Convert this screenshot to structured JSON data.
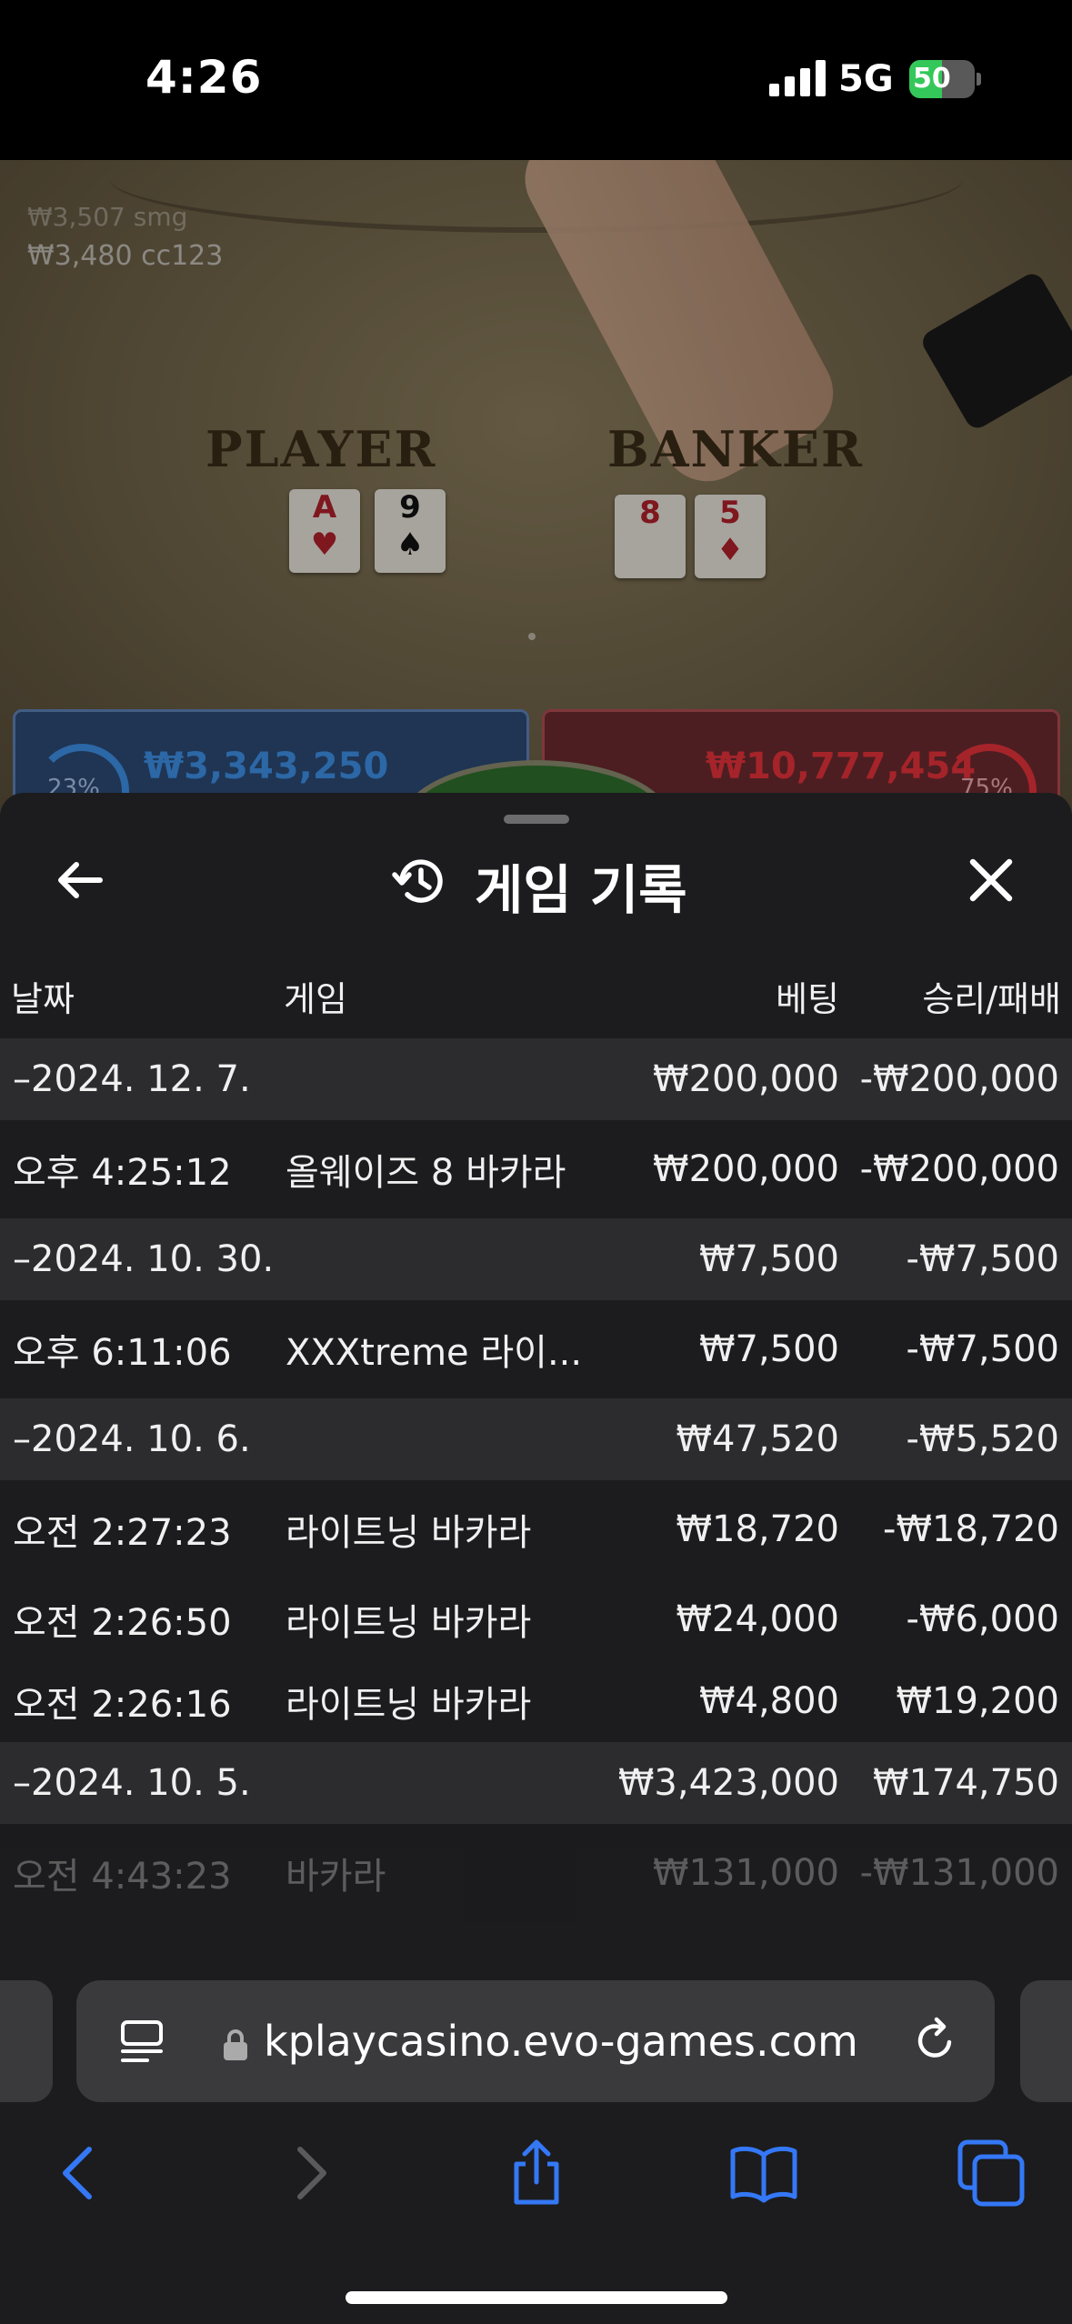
{
  "status_bar": {
    "time": "4:26",
    "network": "5G",
    "battery": "50",
    "battery_level": 0.5,
    "battery_color": "#34c759"
  },
  "game_view": {
    "dealer_line_dim": "₩3,507 smg",
    "dealer_line": "₩3,480  cc123",
    "player_label": "PLAYER",
    "banker_label": "BANKER",
    "player_cards": [
      {
        "rank": "A",
        "suit": "♥",
        "color": "red"
      },
      {
        "rank": "9",
        "suit": "♠",
        "color": "black"
      }
    ],
    "banker_cards": [
      {
        "rank": "8",
        "suit": "",
        "color": "red"
      },
      {
        "rank": "5",
        "suit": "♦",
        "color": "red"
      }
    ],
    "player_bet_total": "₩3,343,250",
    "banker_bet_total": "₩10,777,454",
    "player_pct": "23%",
    "banker_pct": "75%",
    "player_color": "#3d8fe6",
    "banker_color": "#e5323b"
  },
  "sheet": {
    "title": "게임 기록",
    "columns": {
      "date": "날짜",
      "game": "게임",
      "bet": "베팅",
      "result": "승리/패배"
    },
    "rows": [
      {
        "type": "group",
        "date": "–2024. 12. 7.",
        "game": "",
        "bet": "₩200,000",
        "result": "-₩200,000"
      },
      {
        "type": "detail",
        "date": "오후 4:25:12",
        "game": "올웨이즈 8 바카라",
        "bet": "₩200,000",
        "result": "-₩200,000"
      },
      {
        "type": "group",
        "date": "–2024. 10. 30.",
        "game": "",
        "bet": "₩7,500",
        "result": "-₩7,500"
      },
      {
        "type": "detail",
        "date": "오후 6:11:06",
        "game": "XXXtreme 라이...",
        "bet": "₩7,500",
        "result": "-₩7,500"
      },
      {
        "type": "group",
        "date": "–2024. 10. 6.",
        "game": "",
        "bet": "₩47,520",
        "result": "-₩5,520"
      },
      {
        "type": "detail",
        "date": "오전 2:27:23",
        "game": "라이트닝 바카라",
        "bet": "₩18,720",
        "result": "-₩18,720"
      },
      {
        "type": "detail",
        "date": "오전 2:26:50",
        "game": "라이트닝 바카라",
        "bet": "₩24,000",
        "result": "-₩6,000"
      },
      {
        "type": "detail",
        "date": "오전 2:26:16",
        "game": "라이트닝 바카라",
        "bet": "₩4,800",
        "result": "₩19,200"
      },
      {
        "type": "group",
        "date": "–2024. 10. 5.",
        "game": "",
        "bet": "₩3,423,000",
        "result": "₩174,750"
      },
      {
        "type": "detail",
        "date": "오전 4:43:23",
        "game": "바카라",
        "bet": "₩131,000",
        "result": "-₩131,000",
        "faded": true
      }
    ]
  },
  "browser": {
    "url": "kplaycasino.evo-games.com",
    "accent_color": "#3478f6"
  }
}
